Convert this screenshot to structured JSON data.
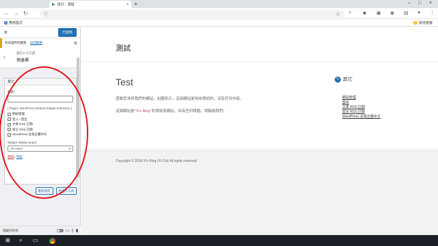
{
  "browser": {
    "tab_title": "自訂：測試",
    "url": "",
    "bookmark_apps": "應用程式",
    "bookmark_other": "其他書籤"
  },
  "customizer": {
    "publish_label": "已發佈",
    "notice_text": "有未儲存的變更",
    "notice_link": "返回變更",
    "breadcrumb": "自訂 ▸ 小工具",
    "section_title": "側邊欄",
    "widget": {
      "name": "其它",
      "title_label": "標題：",
      "title_value": "",
      "plugin_note": "[ Plugin: WordPress Default Widget Extension ]",
      "options": [
        {
          "label": "網站管理",
          "checked": true
        },
        {
          "label": "登入 / 登出",
          "checked": true
        },
        {
          "label": "文章 RSS 訂閱",
          "checked": true
        },
        {
          "label": "留言 RSS 訂閱",
          "checked": true
        },
        {
          "label": "WordPress 台灣正體中文",
          "checked": true
        }
      ],
      "display_target_label": "Widget display target:",
      "display_target_value": "All Users",
      "delete_link": "移除",
      "done_link": "完成"
    },
    "reorder_button": "重新排序",
    "add_widget_button": "新增小工具",
    "footer_collapse": "隱藏控制項"
  },
  "preview": {
    "site_title": "測試",
    "post_title": "Test",
    "paragraph_1": "感謝您來到我們的網站，如圖所示，這個網站是用來測試的，沒有任何內容。",
    "paragraph_2_prefix": "這個網站是",
    "paragraph_2_link": "\"Yi's Blog\"",
    "paragraph_2_suffix": "的測試用網站，如有任何問題，請聯絡我們。",
    "sidebar_title": "其它",
    "meta_links": [
      "網站管理",
      "登出",
      "文章 RSS 訂閱",
      "留言 RSS 訂閱",
      "WordPress 台灣正體中文"
    ],
    "copyright": "Copyright © 2018 Yi's Blog (Yi Chi) All rights reserved."
  },
  "colors": {
    "accent": "#2271b1",
    "annotation": "#e0151c"
  },
  "icons": {
    "tab_favicon": "play-icon",
    "sidebar_widget_icon": "pencil-icon"
  }
}
